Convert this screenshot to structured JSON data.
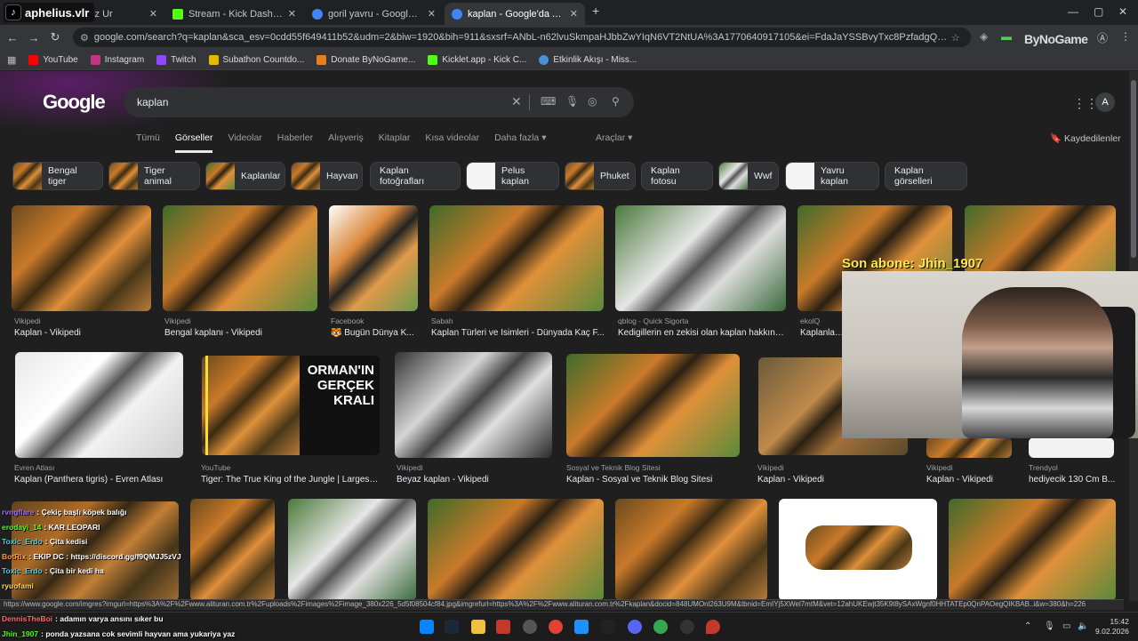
{
  "overlay_channel": "aphelius.vlr",
  "tabs": [
    {
      "title": "feat. İffetsiz Ur",
      "fav_color": "#c00"
    },
    {
      "title": "Stream - Kick Dashboard",
      "fav_color": "#53fc18"
    },
    {
      "title": "goril yavru - Google'da Ara",
      "fav_color": "#4285f4"
    },
    {
      "title": "kaplan - Google'da Ara",
      "fav_color": "#4285f4"
    }
  ],
  "new_tab": "+",
  "url": "google.com/search?q=kaplan&sca_esv=0cdd55f649411b52&udm=2&biw=1920&bih=911&sxsrf=ANbL-n62lvuSkmpaHJbbZwYIqN6VT2NtUA%3A1770640917105&ei=FdaJaYSSBvyTxc8PzfadgQQ&ved=0ahUKEwjE8I23t8ySAxX8SfED...",
  "ext_brand": "ByNoGame",
  "bookmarks": [
    {
      "label": "YouTube",
      "color": "#f00"
    },
    {
      "label": "Instagram",
      "color": "#c13584"
    },
    {
      "label": "Twitch",
      "color": "#9146ff"
    },
    {
      "label": "Subathon Countdo...",
      "color": "#e6b800"
    },
    {
      "label": "Donate ByNoGame...",
      "color": "#e67e22"
    },
    {
      "label": "Kicklet.app - Kick C...",
      "color": "#53fc18"
    },
    {
      "label": "Etkinlik Akışı - Miss...",
      "color": "#4a90d9"
    }
  ],
  "google": {
    "logo": "Google",
    "query": "kaplan",
    "avatar": "A",
    "nav_tabs": [
      "Tümü",
      "Görseller",
      "Videolar",
      "Haberler",
      "Alışveriş",
      "Kitaplar",
      "Kısa videolar",
      "Daha fazla ▾"
    ],
    "tools": "Araçlar ▾",
    "saved": "Kaydedilenler",
    "chips": [
      "Bengal tiger",
      "Tiger animal",
      "Kaplanlar",
      "Hayvan",
      "Kaplan fotoğrafları",
      "Pelus kaplan",
      "Phuket",
      "Kaplan fotosu",
      "Wwf",
      "Yavru kaplan",
      "Kaplan görselleri"
    ],
    "row1": [
      {
        "source": "Vikipedi",
        "title": "Kaplan - Vikipedi"
      },
      {
        "source": "Vikipedi",
        "title": "Bengal kaplanı - Vikipedi"
      },
      {
        "source": "Facebook",
        "title": "🐯 Bugün Dünya K..."
      },
      {
        "source": "Sabah",
        "title": "Kaplan Türleri ve İsimleri - Dünyada Kaç F..."
      },
      {
        "source": "qblog - Quick Sigorta",
        "title": "Kedigillerin en zekisi olan kaplan hakkınd..."
      },
      {
        "source": "ekolQ",
        "title": "Kaplanların"
      }
    ],
    "row2": [
      {
        "source": "Evren Atlası",
        "title": "Kaplan (Panthera tigris) - Evren Atlası"
      },
      {
        "source": "YouTube",
        "title": "Tiger: The True King of the Jungle | Largest ..."
      },
      {
        "source": "Vikipedi",
        "title": "Beyaz kaplan - Vikipedi"
      },
      {
        "source": "Sosyal ve Teknik Blog Sitesi",
        "title": "Kaplan - Sosyal ve Teknik Blog Sitesi"
      },
      {
        "source": "Vikipedi",
        "title": "Kaplan - Vikipedi"
      },
      {
        "source": "Vikipedi",
        "title": "Kaplan - Vikipedi"
      },
      {
        "source": "Trendyol",
        "title": "hediyecik 130 Cm B..."
      }
    ],
    "yt_thumb_text": "ORMAN'IN GERÇEK KRALI"
  },
  "stream": {
    "sub_alert": "Son abone: Jhin_1907",
    "chat": [
      {
        "name": "rvngflare",
        "msg": ": Çekiç başlı köpek balığı",
        "color": "#a06cff"
      },
      {
        "name": "erodayi_14",
        "msg": ": KAR LEOPARI",
        "color": "#53fc18"
      },
      {
        "name": "Toxic_Erdo",
        "msg": ": Çita kedisi",
        "color": "#4dd0e1"
      },
      {
        "name": "BotRix",
        "msg": ": EKIP DC : https://discord.gg/f9QMJJ5zVJ",
        "color": "#ff9a3c"
      },
      {
        "name": "Toxic_Erdo",
        "msg": ": Çita bir kedi ha",
        "color": "#4dd0e1"
      },
      {
        "name": "ryuofami",
        "msg": "",
        "color": "#ffd54f"
      }
    ],
    "chat_bottom": [
      {
        "name": "DennisTheBoi",
        "msg": ": adamın varya ansını sıker bu",
        "color": "#ff6b6b"
      },
      {
        "name": "Jhin_1907",
        "msg": ": ponda yazsana cok sevimli hayvan ama yukariya yaz",
        "color": "#53fc18"
      }
    ]
  },
  "status_url": "https://www.google.com/imgres?imgurl=https%3A%2F%2Fwww.alituran.com.tr%2Fuploads%2Fimages%2Fimage_380x226_5d5f08504cf84.jpg&imgrefurl=https%3A%2F%2Fwww.alituran.com.tr%2Fkaplan&docid=848UMOnl263U9M&tbnid=EmIYj5XWel7mtM&vet=12ahUKEwjt35K9t8ySAxWgnf0HHTATEp0QnPAOegQIKBAB..i&w=380&h=226",
  "clock": {
    "time": "15:42",
    "date": "9.02.2026"
  }
}
